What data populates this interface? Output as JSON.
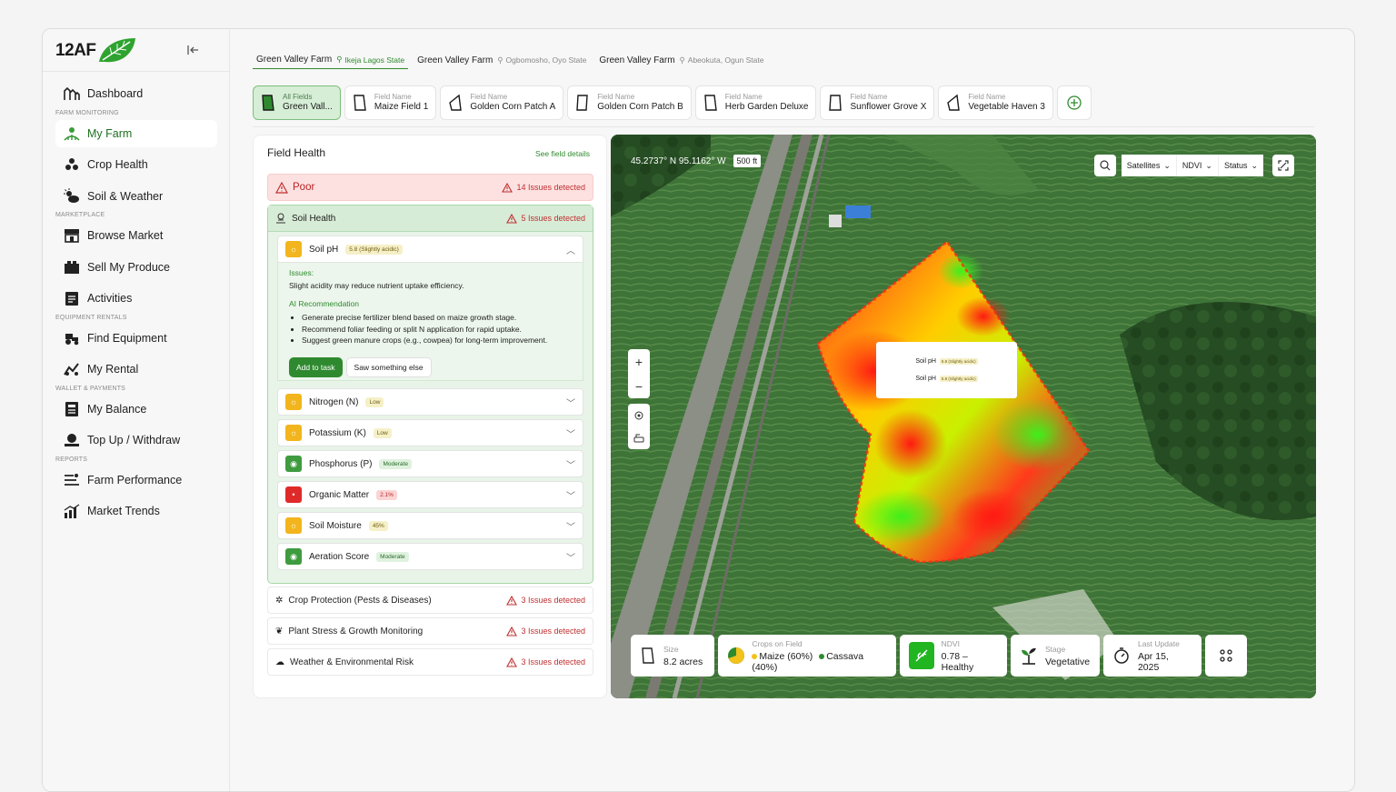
{
  "brand": {
    "name": "12AF"
  },
  "sidebar": {
    "items": [
      {
        "label": "Dashboard"
      },
      {
        "section": "FARM MONITORING"
      },
      {
        "label": "My Farm"
      },
      {
        "label": "Crop Health"
      },
      {
        "label": "Soil & Weather"
      },
      {
        "section": "MARKETPLACE"
      },
      {
        "label": "Browse Market"
      },
      {
        "label": "Sell My Produce"
      },
      {
        "label": "Activities"
      },
      {
        "section": "EQUIPMENT RENTALS"
      },
      {
        "label": "Find Equipment"
      },
      {
        "label": "My Rental"
      },
      {
        "section": "WALLET & PAYMENTS"
      },
      {
        "label": "My Balance"
      },
      {
        "label": "Top Up / Withdraw"
      },
      {
        "section": "REPORTS"
      },
      {
        "label": "Farm Performance"
      },
      {
        "label": "Market Trends"
      }
    ]
  },
  "farms": [
    {
      "name": "Green Valley Farm",
      "location": "Ikeja Lagos State"
    },
    {
      "name": "Green Valley Farm",
      "location": "Ogbomosho, Oyo State"
    },
    {
      "name": "Green Valley Farm",
      "location": "Abeokuta, Ogun State"
    }
  ],
  "fields": [
    {
      "label": "All Fields",
      "value": "Green Vall..."
    },
    {
      "label": "Field Name",
      "value": "Maize Field 1"
    },
    {
      "label": "Field Name",
      "value": "Golden Corn Patch A"
    },
    {
      "label": "Field Name",
      "value": "Golden Corn Patch B"
    },
    {
      "label": "Field Name",
      "value": "Herb Garden Deluxe"
    },
    {
      "label": "Field Name",
      "value": "Sunflower Grove X"
    },
    {
      "label": "Field Name",
      "value": "Vegetable Haven 3"
    }
  ],
  "health": {
    "title": "Field Health",
    "link": "See field details",
    "status": "Poor",
    "status_issues": "14 Issues detected",
    "soil": {
      "title": "Soil Health",
      "issues": "5 Issues detected"
    },
    "ph": {
      "name": "Soil pH",
      "badge": "5.8 (Slightly acidic)"
    },
    "issues_label": "Issues:",
    "issues_text": "Slight acidity may reduce nutrient uptake efficiency.",
    "ai_label": "AI Recommendation",
    "recs": [
      "Generate precise fertilizer blend based on maize growth stage.",
      "Recommend foliar feeding or split N application for rapid uptake.",
      "Suggest green manure crops (e.g., cowpea) for long-term improvement."
    ],
    "add_task": "Add to task",
    "saw_else": "Saw something else",
    "metrics": [
      {
        "name": "Nitrogen (N)",
        "badge": "Low"
      },
      {
        "name": "Potassium (K)",
        "badge": "Low"
      },
      {
        "name": "Phosphorus (P)",
        "badge": "Moderate"
      },
      {
        "name": "Organic Matter",
        "badge": "2.1%"
      },
      {
        "name": "Soil Moisture",
        "badge": "45%"
      },
      {
        "name": "Aeration Score",
        "badge": "Moderate"
      }
    ],
    "others": [
      {
        "name": "Crop Protection (Pests & Diseases)",
        "issues": "3 Issues detected"
      },
      {
        "name": "Plant Stress & Growth Monitoring",
        "issues": "3 Issues detected"
      },
      {
        "name": "Weather & Environmental Risk",
        "issues": "3 Issues detected"
      }
    ]
  },
  "map": {
    "coords": "45.2737° N 95.1162° W",
    "scale": "500 ft",
    "layer": "Satellites",
    "index": "NDVI",
    "status": "Status",
    "popup": [
      {
        "label": "Soil pH",
        "badge": "5.8 (Slightly acidic)"
      },
      {
        "label": "Soil pH",
        "badge": "5.8 (Slightly acidic)"
      }
    ]
  },
  "stats": {
    "size": {
      "label": "Size",
      "value": "8.2 acres"
    },
    "crops": {
      "label": "Crops on Field",
      "maize": "Maize (60%)",
      "cassava": "Cassava (40%)"
    },
    "ndvi": {
      "label": "NDVI",
      "value": "0.78 – Healthy"
    },
    "stage": {
      "label": "Stage",
      "value": "Vegetative"
    },
    "update": {
      "label": "Last Update",
      "value": "Apr 15, 2025"
    }
  },
  "colors": {
    "accent": "#2f8a2f",
    "danger": "#c03030",
    "warn": "#f2b51d"
  }
}
